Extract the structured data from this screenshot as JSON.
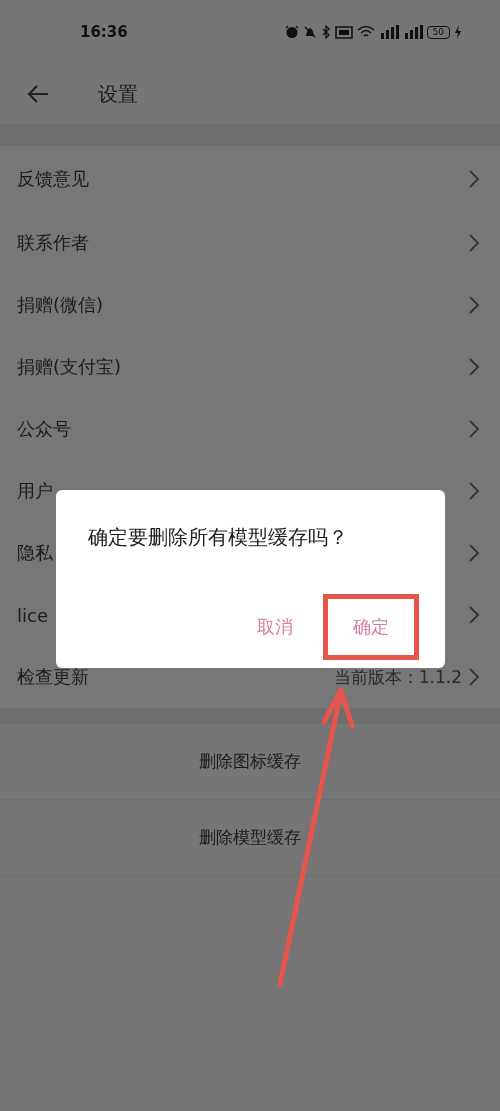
{
  "status_bar": {
    "time": "16:36",
    "battery_text": "50"
  },
  "header": {
    "title": "设置"
  },
  "settings_items": [
    {
      "label": "反馈意见"
    },
    {
      "label": "联系作者"
    },
    {
      "label": "捐赠(微信)"
    },
    {
      "label": "捐赠(支付宝)"
    },
    {
      "label": "公众号"
    },
    {
      "label": "用户"
    },
    {
      "label": "隐私"
    },
    {
      "label": "lice"
    },
    {
      "label": "检查更新",
      "value": "当前版本：1.1.2"
    }
  ],
  "actions": [
    {
      "label": "删除图标缓存"
    },
    {
      "label": "删除模型缓存"
    }
  ],
  "dialog": {
    "message": "确定要删除所有模型缓存吗？",
    "buttons": [
      {
        "label": "取消",
        "highlighted": false
      },
      {
        "label": "确定",
        "highlighted": true
      }
    ]
  }
}
